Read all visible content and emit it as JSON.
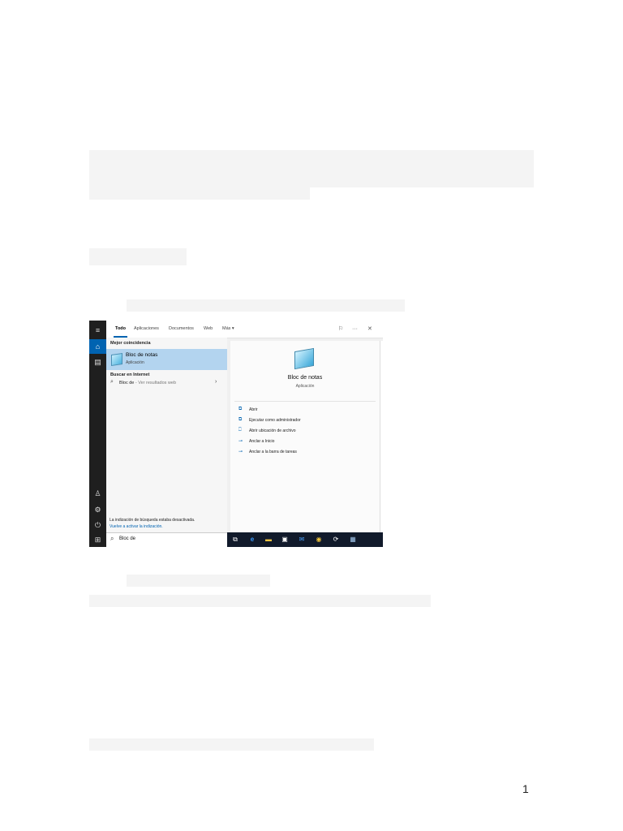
{
  "page_number": "1",
  "screenshot": {
    "tabs": [
      "Todo",
      "Aplicaciones",
      "Documentos",
      "Web",
      "Más ▾"
    ],
    "left_panel": {
      "best_match_header": "Mejor coincidencia",
      "best_match_title": "Bloc de notas",
      "best_match_subtitle": "Aplicación",
      "internet_header": "Buscar en Internet",
      "web_query": "Bloc de",
      "web_suffix": " - Ver resultados web",
      "index_notice": "La indización de búsqueda estaba desactivada.",
      "index_link": "Vuelve a activar la indización."
    },
    "search_query": "Bloc de",
    "right_panel": {
      "app_title": "Bloc de notas",
      "app_subtitle": "Aplicación",
      "actions": [
        "Abrir",
        "Ejecutar como administrador",
        "Abrir ubicación de archivo",
        "Anclar a Inicio",
        "Anclar a la barra de tareas"
      ]
    },
    "icons": {
      "rail": [
        "hamburger-icon",
        "home-icon",
        "document-icon",
        "person-icon",
        "gear-icon",
        "power-icon",
        "windows-icon"
      ],
      "taskbar": [
        "task-view-icon",
        "edge-icon",
        "file-explorer-icon",
        "store-icon",
        "mail-icon",
        "chrome-icon",
        "sync-icon",
        "calculator-icon"
      ]
    },
    "colors": {
      "accent": "#0063b1",
      "selection": "#b3d4ef",
      "taskbar": "#111a2b",
      "rail": "#1f1f1f"
    }
  }
}
